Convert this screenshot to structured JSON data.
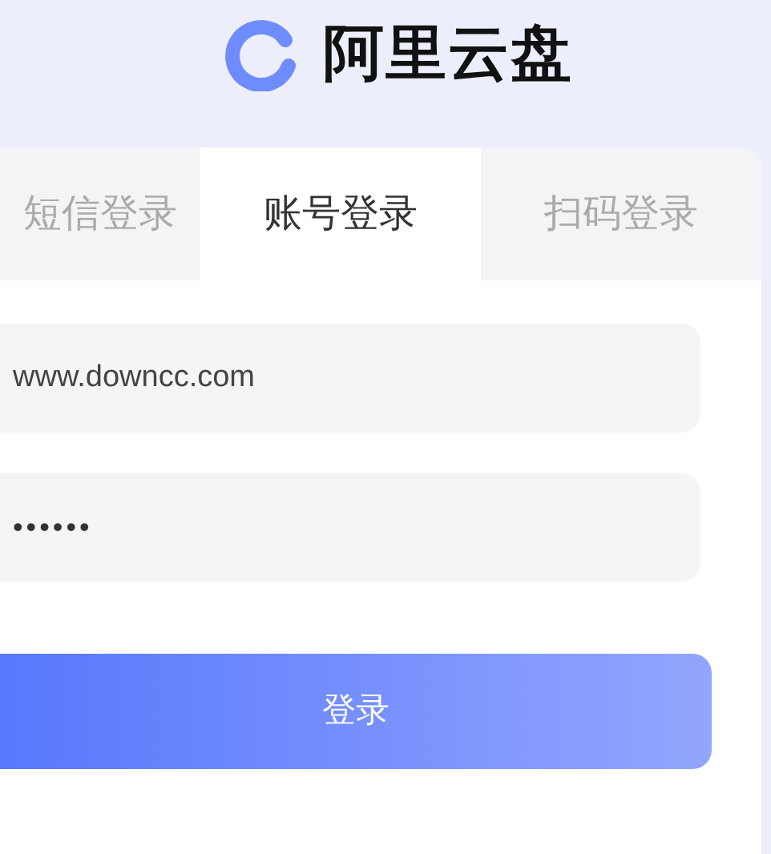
{
  "logo": {
    "text": "阿里云盘"
  },
  "tabs": [
    {
      "label": "短信登录",
      "selected": false
    },
    {
      "label": "账号登录",
      "selected": true
    },
    {
      "label": "扫码登录",
      "selected": false
    }
  ],
  "fields": [
    {
      "kind": "text",
      "value": "www.downcc.com"
    },
    {
      "kind": "password",
      "value": "••••••"
    }
  ],
  "login_button": "登录"
}
